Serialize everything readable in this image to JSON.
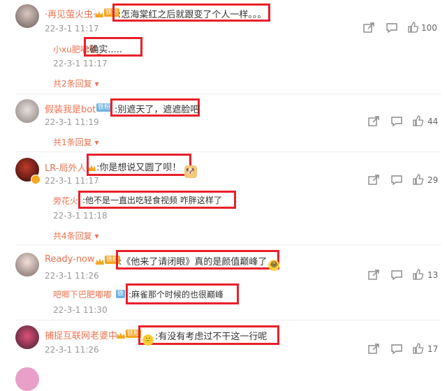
{
  "comments": [
    {
      "user": "·再见萤火虫·",
      "badge": "铁粉",
      "text": ":怎海棠红之后就跟变了个人一样。。。",
      "time": "22-3-1 11:17",
      "likes": "100",
      "replies": [
        {
          "user": "小xu肥嘟嘟_",
          "text": ":确实.....",
          "time": "22-3-1 11:17"
        }
      ],
      "more": "共2条回复"
    },
    {
      "user": "假装我是bot",
      "badge": "铁粉",
      "text": ":别遮天了，遮遮脸吧",
      "time": "22-3-1 11:19",
      "likes": "44",
      "replies": [],
      "more": "共1条回复"
    },
    {
      "user": "LR-局外人",
      "text": ":你是想说又圆了呗！",
      "time": "22-3-1 11:17",
      "likes": "29",
      "replies": [
        {
          "user": "旁花火",
          "text": ":他不是一直出吃轻食视频 咋胖这样了",
          "time": "22-3-1 11:18"
        }
      ],
      "more": "共4条回复"
    },
    {
      "user": "Ready-now",
      "badge": "铁粉",
      "text": ":《他来了请闭眼》真的是颜值巅峰了",
      "time": "22-3-1 11:26",
      "likes": "13",
      "replies": [
        {
          "user": "吧唧下巴肥嘟嘟",
          "badge": "铁",
          "text": ":麻雀那个时候的也很巅峰",
          "time": "22-3-1 11:30"
        }
      ],
      "more": ""
    },
    {
      "user": "捕捉互联网老婆中",
      "badge": "铁粉",
      "text": ":有没有考虑过不干这一行呢",
      "time": "22-3-1 11:26",
      "likes": "17",
      "replies": [],
      "more": ""
    }
  ],
  "colors": {
    "accent": "#eb7350",
    "highlight": "#e8202a"
  }
}
